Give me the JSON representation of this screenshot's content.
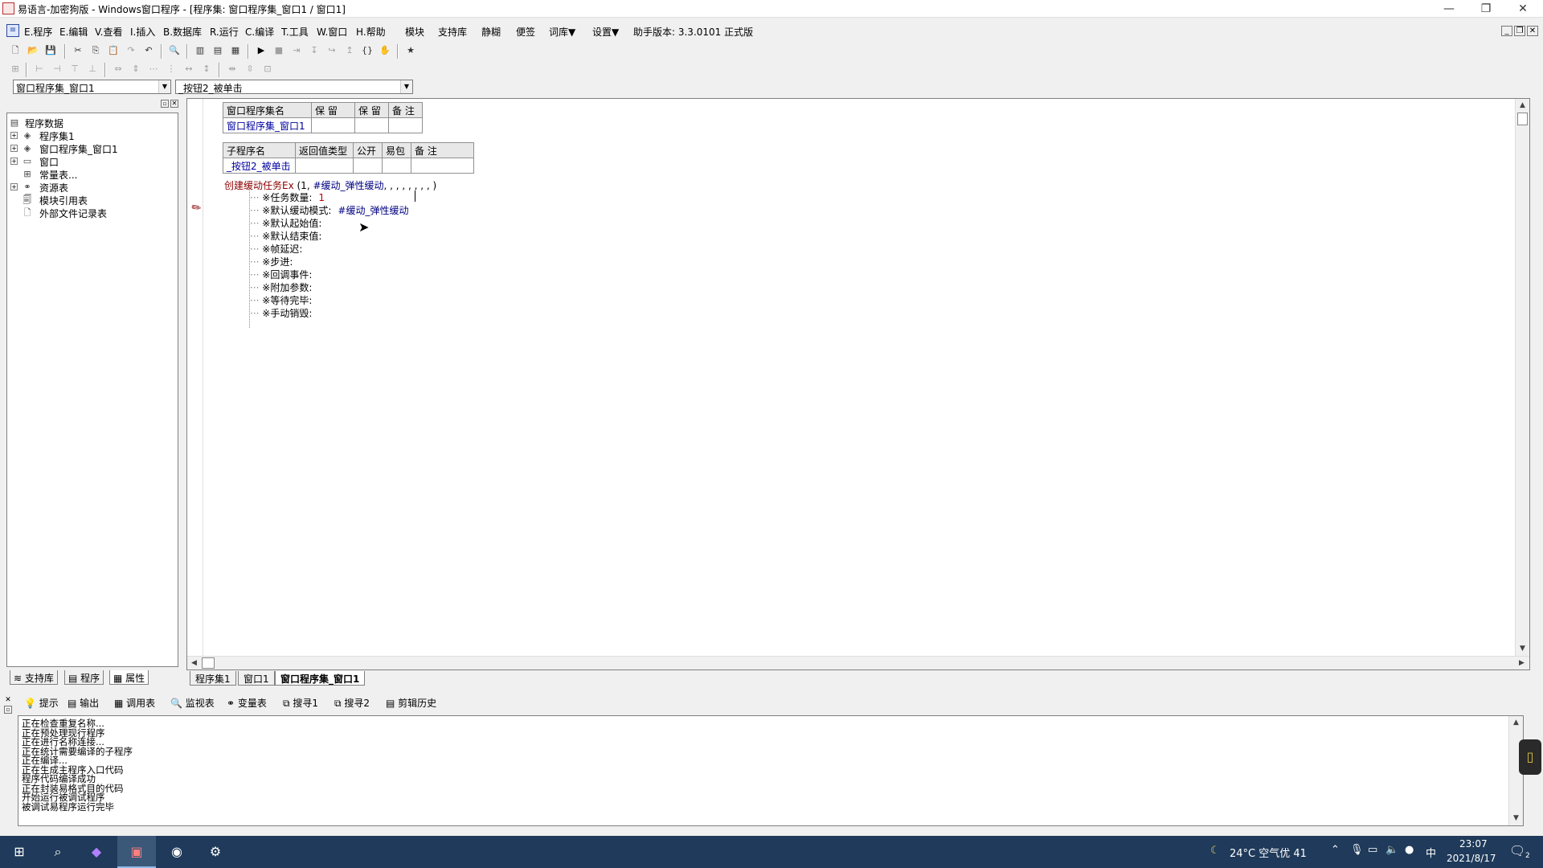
{
  "window": {
    "title": "易语言-加密狗版 - Windows窗口程序 - [程序集: 窗口程序集_窗口1 / 窗口1]",
    "minimize": "—",
    "restore": "❐",
    "close": "✕"
  },
  "menu": {
    "items": [
      "E.程序",
      "E.编辑",
      "V.查看",
      "I.插入",
      "B.数据库",
      "R.运行",
      "C.编译",
      "T.工具",
      "W.窗口",
      "H.帮助",
      "模块",
      "支持库",
      "静糊",
      "便签",
      "词库▼",
      "设置▼",
      "助手版本: 3.3.0101 正式版"
    ]
  },
  "toolbar": {
    "combo_left": "窗口程序集_窗口1",
    "combo_right": "_按钮2_被单击"
  },
  "tree": {
    "root": "程序数据",
    "items": [
      "程序集1",
      "窗口程序集_窗口1",
      "窗口",
      "常量表...",
      "资源表",
      "模块引用表",
      "外部文件记录表"
    ]
  },
  "left_tabs": [
    "支持库",
    "程序",
    "属性"
  ],
  "assembly_table": {
    "headers": [
      "窗口程序集名",
      "保 留",
      "保 留",
      "备 注"
    ],
    "row": [
      "窗口程序集_窗口1",
      "",
      "",
      ""
    ]
  },
  "sub_table": {
    "headers": [
      "子程序名",
      "返回值类型",
      "公开",
      "易包",
      "备 注"
    ],
    "row": [
      "_按钮2_被单击",
      "",
      "",
      "",
      ""
    ]
  },
  "code": {
    "call_fn": "创建缓动任务Ex",
    "call_args_pre": " (1, ",
    "call_const": "#缓动_弹性缓动",
    "call_args_post": ", , , , , , , , )",
    "params": [
      {
        "label": "※任务数量:",
        "value": "1",
        "kind": "num"
      },
      {
        "label": "※默认缓动模式:",
        "value": "#缓动_弹性缓动",
        "kind": "const"
      },
      {
        "label": "※默认起始值:",
        "value": "",
        "kind": ""
      },
      {
        "label": "※默认结束值:",
        "value": "",
        "kind": ""
      },
      {
        "label": "※帧延迟:",
        "value": "",
        "kind": ""
      },
      {
        "label": "※步进:",
        "value": "",
        "kind": ""
      },
      {
        "label": "※回调事件:",
        "value": "",
        "kind": ""
      },
      {
        "label": "※附加参数:",
        "value": "",
        "kind": ""
      },
      {
        "label": "※等待完毕:",
        "value": "",
        "kind": ""
      },
      {
        "label": "※手动销毁:",
        "value": "",
        "kind": ""
      }
    ]
  },
  "editor_tabs": [
    "程序集1",
    "窗口1",
    "窗口程序集_窗口1"
  ],
  "output_tabs": [
    "提示",
    "输出",
    "调用表",
    "监视表",
    "变量表",
    "搜寻1",
    "搜寻2",
    "剪辑历史"
  ],
  "output_lines": [
    "正在检查重复名称...",
    "正在预处理现行程序",
    "正在进行名称连接...",
    "正在统计需要编译的子程序",
    "正在编译...",
    "正在生成主程序入口代码",
    "程序代码编译成功",
    "正在封装易格式目的代码",
    "开始运行被调试程序",
    "被调试易程序运行完毕"
  ],
  "taskbar": {
    "weather": "24°C 空气优 41",
    "ime": "中",
    "time": "23:07",
    "date": "2021/8/17",
    "notif_count": "2"
  }
}
